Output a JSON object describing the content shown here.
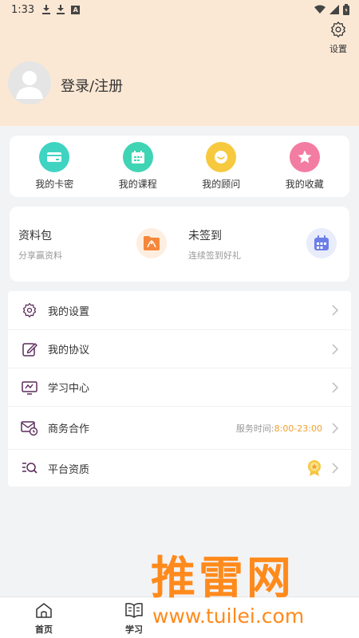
{
  "status_bar": {
    "time": "1:33"
  },
  "header": {
    "settings_label": "设置",
    "login_text": "登录/注册"
  },
  "quick_actions": [
    {
      "label": "我的卡密",
      "icon": "card-icon",
      "color": "#3fd4c2"
    },
    {
      "label": "我的课程",
      "icon": "calendar-icon",
      "color": "#3fd4b4"
    },
    {
      "label": "我的顾问",
      "icon": "chat-bubble-icon",
      "color": "#f7c93e"
    },
    {
      "label": "我的收藏",
      "icon": "star-icon",
      "color": "#f37ca2"
    }
  ],
  "promos": [
    {
      "title": "资料包",
      "subtitle": "分享赢资料",
      "icon": "pdf-folder-icon",
      "color": "#f5873a"
    },
    {
      "title": "未签到",
      "subtitle": "连续签到好礼",
      "icon": "checkin-calendar-icon",
      "color": "#6b7ee8"
    }
  ],
  "menu": [
    {
      "label": "我的设置",
      "icon": "gear-icon"
    },
    {
      "label": "我的协议",
      "icon": "edit-icon"
    },
    {
      "label": "学习中心",
      "icon": "monitor-icon"
    },
    {
      "label": "商务合作",
      "icon": "mail-clock-icon",
      "extra_prefix": "服务时间:",
      "extra_hours": "8:00-23:00"
    },
    {
      "label": "平台资质",
      "icon": "search-list-icon",
      "badge_icon": "medal-icon"
    }
  ],
  "bottom_nav": [
    {
      "label": "首页",
      "icon": "home-icon"
    },
    {
      "label": "学习",
      "icon": "book-icon"
    }
  ],
  "watermark": {
    "brand": "推雷网",
    "url": "www.tuilei.com"
  },
  "colors": {
    "header_bg": "#fbe8d4",
    "page_bg": "#f2f3f5",
    "accent": "#f0a030",
    "watermark": "#ff8a1c"
  }
}
